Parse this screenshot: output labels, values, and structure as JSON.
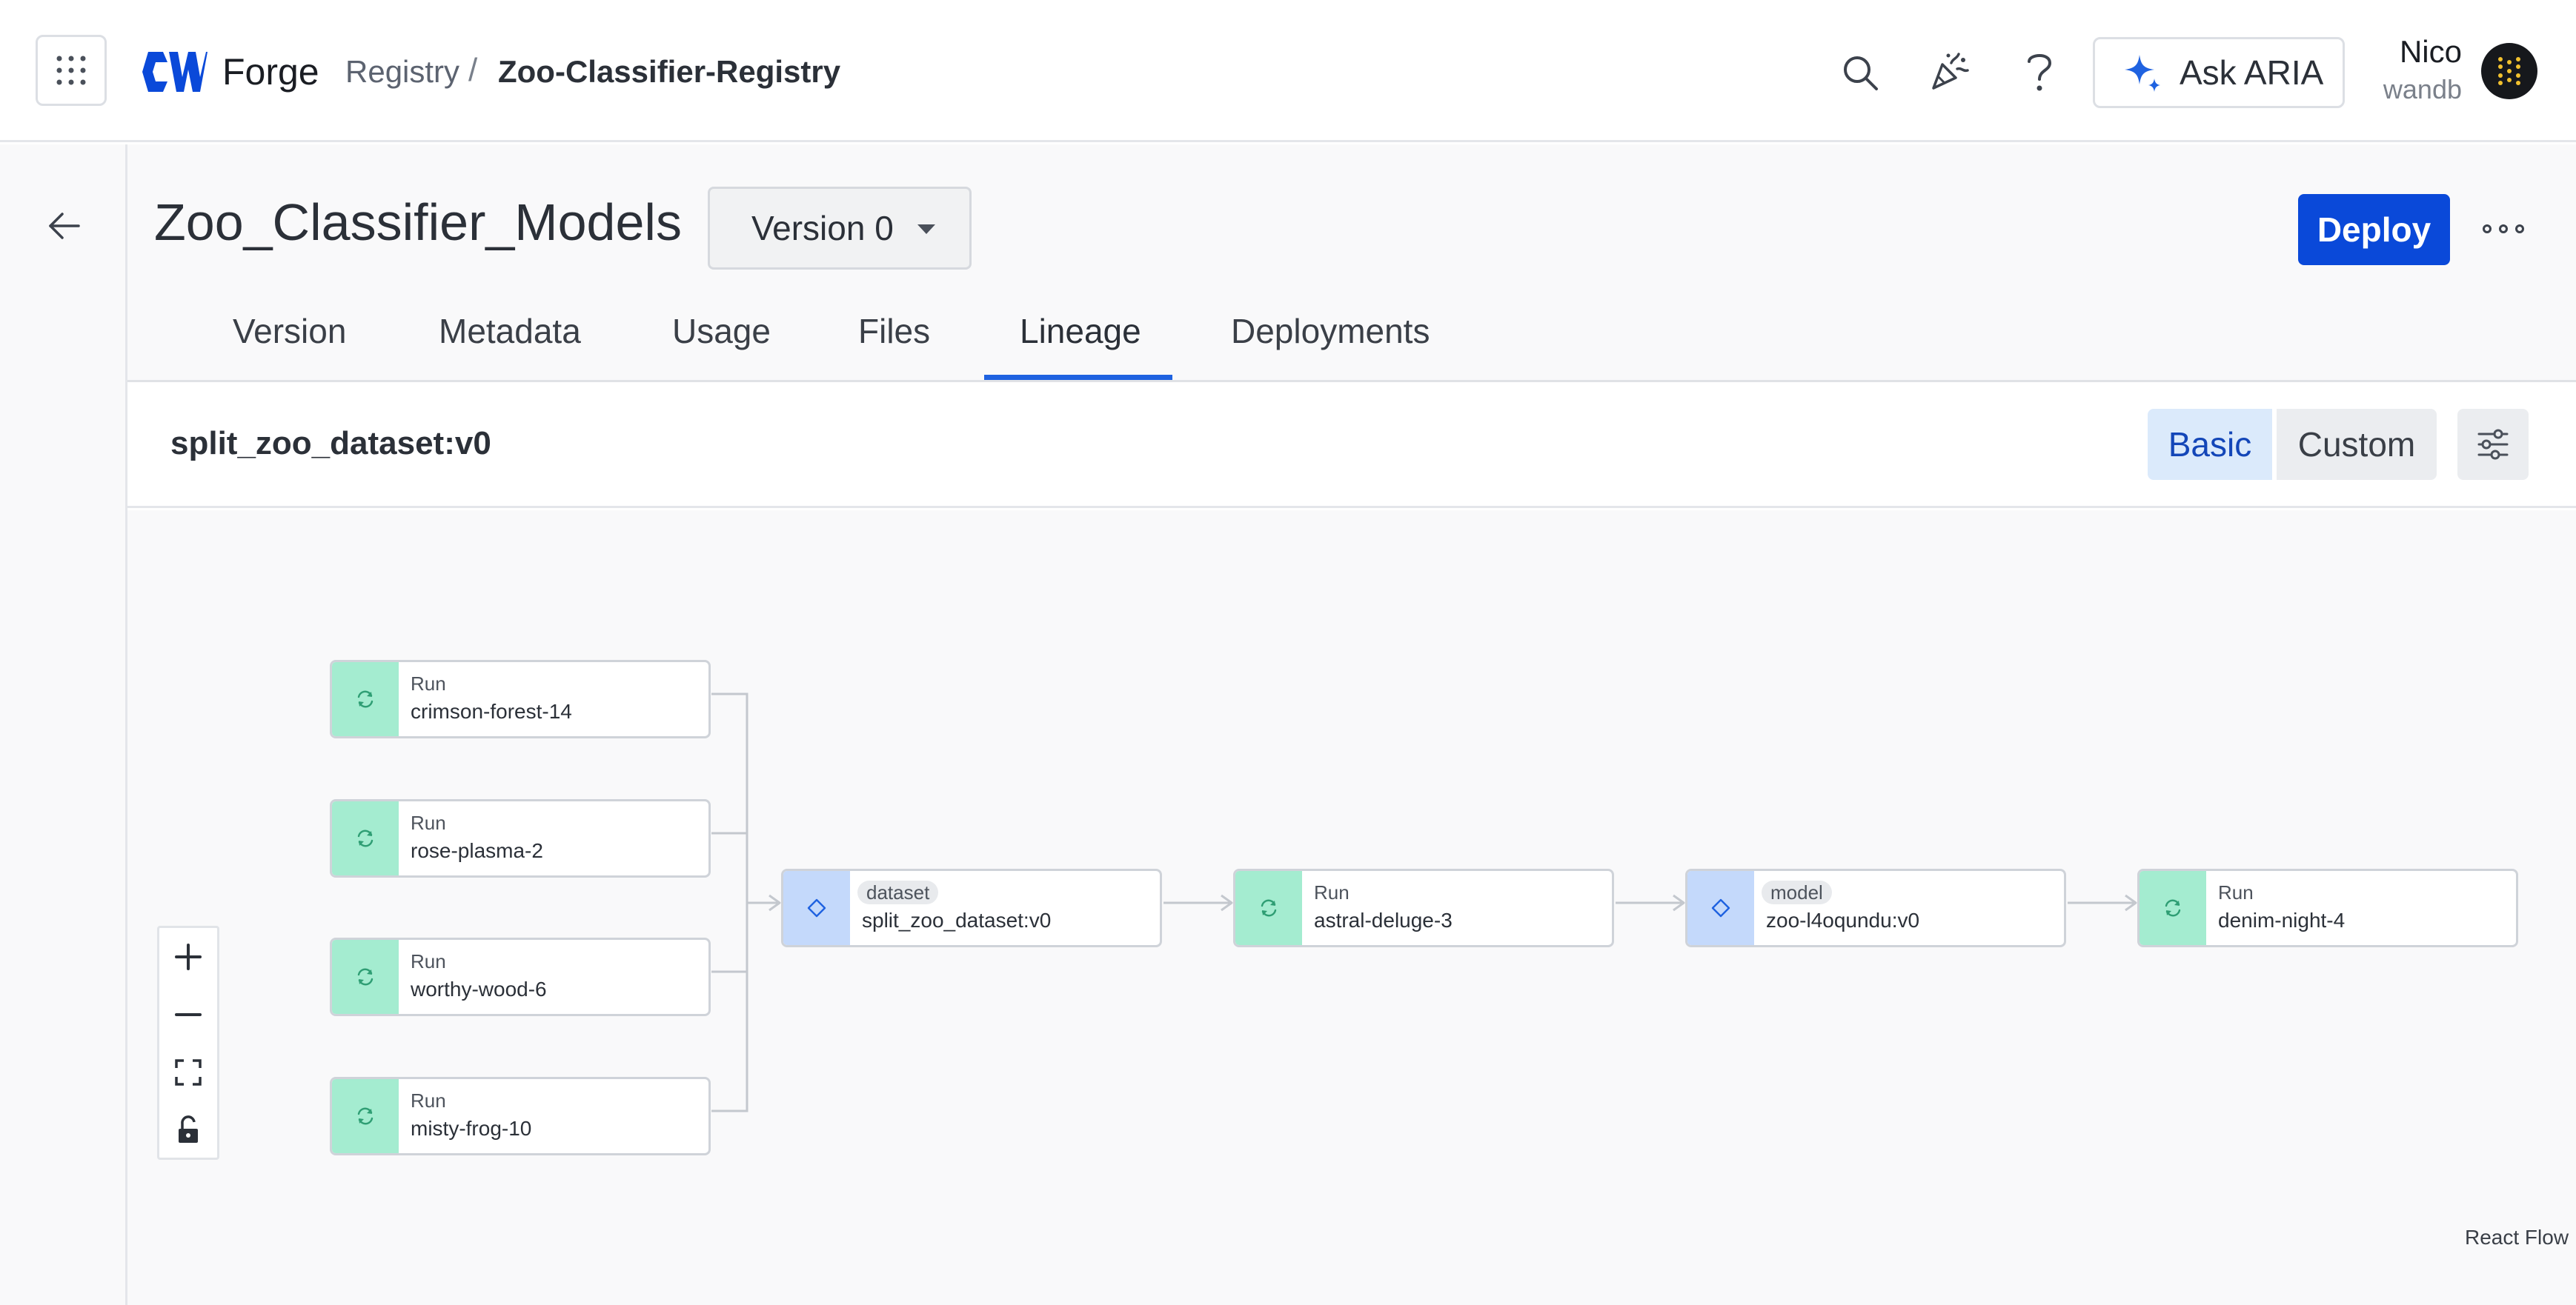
{
  "app": {
    "brand": "Forge",
    "breadcrumb": {
      "parent": "Registry",
      "separator": "/",
      "current": "Zoo-Classifier-Registry"
    },
    "ask_button_label": "Ask ARIA",
    "user": {
      "name": "Nico",
      "org": "wandb"
    }
  },
  "page": {
    "title": "Zoo_Classifier_Models",
    "version_select": "Version 0",
    "deploy_label": "Deploy"
  },
  "tabs": [
    {
      "label": "Version"
    },
    {
      "label": "Metadata"
    },
    {
      "label": "Usage"
    },
    {
      "label": "Files"
    },
    {
      "label": "Lineage",
      "active": true
    },
    {
      "label": "Deployments"
    }
  ],
  "lineage": {
    "title": "split_zoo_dataset:v0",
    "view_toggle": {
      "basic": "Basic",
      "custom": "Custom",
      "selected": "Basic"
    },
    "nodes": [
      {
        "kind": "run",
        "type": "Run",
        "name": "crimson-forest-14"
      },
      {
        "kind": "run",
        "type": "Run",
        "name": "rose-plasma-2"
      },
      {
        "kind": "run",
        "type": "Run",
        "name": "worthy-wood-6"
      },
      {
        "kind": "run",
        "type": "Run",
        "name": "misty-frog-10"
      },
      {
        "kind": "artifact",
        "type": "dataset",
        "name": "split_zoo_dataset:v0"
      },
      {
        "kind": "run",
        "type": "Run",
        "name": "astral-deluge-3"
      },
      {
        "kind": "artifact",
        "type": "model",
        "name": "zoo-l4oqundu:v0"
      },
      {
        "kind": "run",
        "type": "Run",
        "name": "denim-night-4"
      }
    ],
    "attribution": "React Flow"
  },
  "colors": {
    "accent": "#1f62e0",
    "deploy": "#0a49d9",
    "run_node": "#a4ecd0",
    "artifact_node": "#c4d9fb",
    "basic_active_bg": "#dbeafb"
  },
  "icons": {
    "apps": "grid-dots-icon",
    "search": "search-icon",
    "celebrate": "party-popper-icon",
    "help": "question-icon",
    "ask": "sparkle-icon",
    "back": "arrow-left-icon",
    "run": "refresh-icon",
    "artifact": "diamond-icon",
    "settings": "sliders-icon",
    "zoom_in": "plus-icon",
    "zoom_out": "minus-icon",
    "fit": "fit-view-icon",
    "lock": "unlock-icon"
  }
}
